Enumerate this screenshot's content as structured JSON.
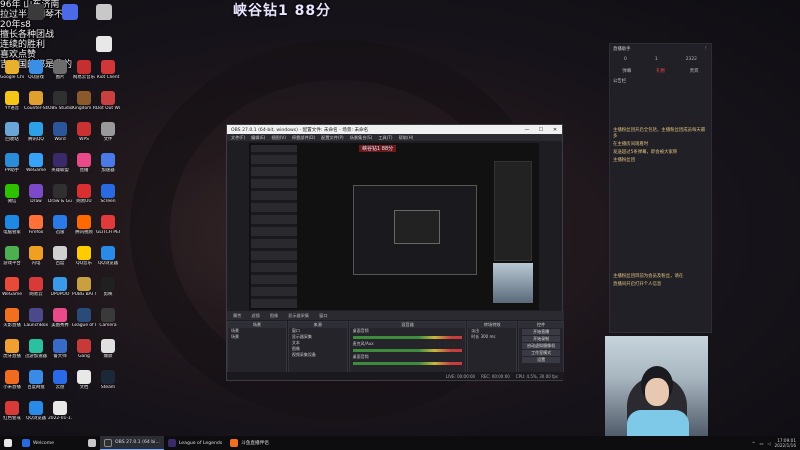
{
  "overlay": {
    "lines": [
      "96年  山东济南",
      "拉过半天钢琴不会",
      "20年s8",
      "擅长各种团战",
      "连续的胜利",
      "喜欢点赞",
      "吉吉国的都是我的"
    ],
    "rank_title": "峡谷钻1  88分"
  },
  "desktop_icons": [
    {
      "label": "Google Chrome",
      "color": "#e8b02c"
    },
    {
      "label": "QQ游戏",
      "color": "#3a8ee6"
    },
    {
      "label": "图片",
      "color": "#6c6c6c"
    },
    {
      "label": "网易云音乐",
      "color": "#c62f2f"
    },
    {
      "label": "Riot Client",
      "color": "#d13639"
    },
    {
      "label": "YY语音",
      "color": "#f5c518"
    },
    {
      "label": "Counter-Strike",
      "color": "#e0a030"
    },
    {
      "label": "OBS Studio",
      "color": "#303030"
    },
    {
      "label": "Kingdom Rush",
      "color": "#8a5a2a"
    },
    {
      "label": "Dot Out World",
      "color": "#c84040"
    },
    {
      "label": "回收站",
      "color": "#6aa4d8"
    },
    {
      "label": "腾讯QQ",
      "color": "#2da0e8"
    },
    {
      "label": "Word",
      "color": "#2b579a"
    },
    {
      "label": "WPS",
      "color": "#c83232"
    },
    {
      "label": "文件",
      "color": "#999999"
    },
    {
      "label": "PP助手",
      "color": "#2b8cd8"
    },
    {
      "label": "WeGame",
      "color": "#36a3f7"
    },
    {
      "label": "英雄联盟",
      "color": "#3a2a6a"
    },
    {
      "label": "直播",
      "color": "#e84a8a"
    },
    {
      "label": "加速器",
      "color": "#4a7ae8"
    },
    {
      "label": "微信",
      "color": "#2dc100"
    },
    {
      "label": "Draw",
      "color": "#7a4ac8"
    },
    {
      "label": "Draw & Guess",
      "color": "#303030"
    },
    {
      "label": "网易UU",
      "color": "#d83030"
    },
    {
      "label": "Screen",
      "color": "#2a6ae0"
    },
    {
      "label": "电脑管家",
      "color": "#1e88e5"
    },
    {
      "label": "Firefox",
      "color": "#ff7139"
    },
    {
      "label": "迅雷",
      "color": "#2a7ae8"
    },
    {
      "label": "腾讯视频",
      "color": "#ff6a00"
    },
    {
      "label": "GLITCH PEOPLE",
      "color": "#e03a3a"
    },
    {
      "label": "游戏平台",
      "color": "#4caf50"
    },
    {
      "label": "闪电",
      "color": "#f0a020"
    },
    {
      "label": "百度",
      "color": "#d0d0d0"
    },
    {
      "label": "QQ音乐",
      "color": "#ffcc00"
    },
    {
      "label": "QQ浏览器",
      "color": "#2a8ae8"
    },
    {
      "label": "WeGame",
      "color": "#e84a3a"
    },
    {
      "label": "网易云",
      "color": "#d83a3a"
    },
    {
      "label": "UPUPOO",
      "color": "#3a9ae8"
    },
    {
      "label": "PUBG BATTLEGR",
      "color": "#c8a040"
    },
    {
      "label": "剪映",
      "color": "#202020"
    },
    {
      "label": "火影直播",
      "color": "#f07020"
    },
    {
      "label": "LaunchBox",
      "color": "#4a4a8a"
    },
    {
      "label": "美图秀秀",
      "color": "#e84a8a"
    },
    {
      "label": "League of Legends",
      "color": "#2a4a7a"
    },
    {
      "label": "Camera",
      "color": "#3a3a3a"
    },
    {
      "label": "虎牙直播",
      "color": "#f0a030"
    },
    {
      "label": "迅游加速器",
      "color": "#2ac0a0"
    },
    {
      "label": "鲁大师",
      "color": "#3a6ac8"
    },
    {
      "label": "Gang",
      "color": "#c83a3a"
    },
    {
      "label": "爆款",
      "color": "#e0e0e0"
    },
    {
      "label": "小米直播",
      "color": "#f06a20"
    },
    {
      "label": "百度网盘",
      "color": "#3a8ae8"
    },
    {
      "label": "云盘",
      "color": "#2a6ae8"
    },
    {
      "label": "文档",
      "color": "#e8e8e8"
    },
    {
      "label": "Steam",
      "color": "#1b2838"
    },
    {
      "label": "红色警戒",
      "color": "#d83a3a"
    },
    {
      "label": "QQ浏览器",
      "color": "#2a8ae8"
    },
    {
      "label": "2022-01-11",
      "color": "#e8e8e8"
    }
  ],
  "obs": {
    "title": "OBS 27.0.1 (64-bit, windows) - 配置文件: 未命名 - 场景: 未命名",
    "menu": [
      "文件(F)",
      "编辑(E)",
      "视图(V)",
      "停靠部件(D)",
      "配置文件(P)",
      "场景集合(S)",
      "工具(T)",
      "帮助(H)"
    ],
    "tag": "峡谷钻1  88分",
    "dock_bar": [
      "属性",
      "滤镜",
      "图像",
      "显示器采集",
      "窗口"
    ],
    "docks": {
      "scenes": {
        "title": "场景",
        "items": [
          "场景",
          "场景"
        ]
      },
      "sources": {
        "title": "来源",
        "items": [
          "窗口",
          "显示器采集",
          "文本",
          "图像",
          "视频采集设备"
        ]
      },
      "mixer": {
        "title": "混音器",
        "items": [
          "桌面音频",
          "麦克风/Aux",
          "桌面音频"
        ]
      },
      "transitions": {
        "title": "转场特效",
        "items": [
          "淡出",
          "时长  300 ms"
        ]
      },
      "controls": {
        "title": "控件",
        "buttons": [
          "开始直播",
          "开始录制",
          "启动虚拟摄像机",
          "工作室模式",
          "设置",
          "退出"
        ]
      }
    },
    "status": [
      "LIVE: 00:00:00",
      "REC: 00:00:00",
      "CPU: 4.5%, 30.00 fps"
    ]
  },
  "chat": {
    "header_left": "直播助手",
    "header_right": "⋮",
    "tabs": [
      "弹幕",
      "礼物",
      "贵宾"
    ],
    "counts": [
      "0",
      "1",
      "2322"
    ],
    "section": "公告栏",
    "notice_lines": [
      "主播粉丝团开启全包括，主播粉丝团成员每天最多",
      "在主播房间观看时",
      "发送超过5条弹幕，即会被大家称",
      "主播粉丝团"
    ],
    "notice2_lines": [
      "主播粉丝团目前为会员及粉丝，请在",
      "直播间开启打开个人信息"
    ]
  },
  "taskbar": {
    "items": [
      {
        "label": "Welcome",
        "color": "#2a6ae0",
        "active": false
      },
      {
        "label": "",
        "color": "#c8c8c8",
        "active": false
      },
      {
        "label": "OBS 27.0.1 (64 bi...",
        "color": "#303030",
        "active": true
      },
      {
        "label": "League of Legends",
        "color": "#3a2a6a",
        "active": false
      },
      {
        "label": "斗鱼直播伴侣",
        "color": "#f07020",
        "active": false
      }
    ],
    "time": "17:09:01",
    "date": "2022/1/16"
  }
}
